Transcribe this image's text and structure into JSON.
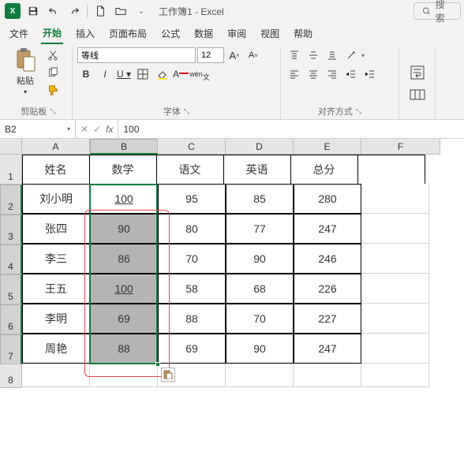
{
  "titlebar": {
    "title": "工作簿1 - Excel",
    "search_placeholder": "搜索"
  },
  "tabs": [
    "文件",
    "开始",
    "插入",
    "页面布局",
    "公式",
    "数据",
    "审阅",
    "视图",
    "帮助"
  ],
  "active_tab": "开始",
  "ribbon": {
    "clipboard": {
      "paste": "粘贴",
      "label": "剪贴板"
    },
    "font": {
      "name": "等线",
      "size": "12",
      "label": "字体",
      "wen": "wén"
    },
    "align": {
      "label": "对齐方式"
    }
  },
  "fbar": {
    "name": "B2",
    "fx": "fx",
    "value": "100"
  },
  "columns": [
    "A",
    "B",
    "C",
    "D",
    "E",
    "F"
  ],
  "rows": [
    "1",
    "2",
    "3",
    "4",
    "5",
    "6",
    "7",
    "8"
  ],
  "table": {
    "headers": [
      "姓名",
      "数学",
      "语文",
      "英语",
      "总分"
    ],
    "data": [
      {
        "name": "刘小明",
        "math": "100",
        "yw": "95",
        "en": "85",
        "sum": "280",
        "ul": true
      },
      {
        "name": "张四",
        "math": "90",
        "yw": "80",
        "en": "77",
        "sum": "247"
      },
      {
        "name": "李三",
        "math": "86",
        "yw": "70",
        "en": "90",
        "sum": "246"
      },
      {
        "name": "王五",
        "math": "100",
        "yw": "58",
        "en": "68",
        "sum": "226",
        "ul": true
      },
      {
        "name": "李明",
        "math": "69",
        "yw": "88",
        "en": "70",
        "sum": "227"
      },
      {
        "name": "周艳",
        "math": "88",
        "yw": "69",
        "en": "90",
        "sum": "247"
      }
    ]
  }
}
